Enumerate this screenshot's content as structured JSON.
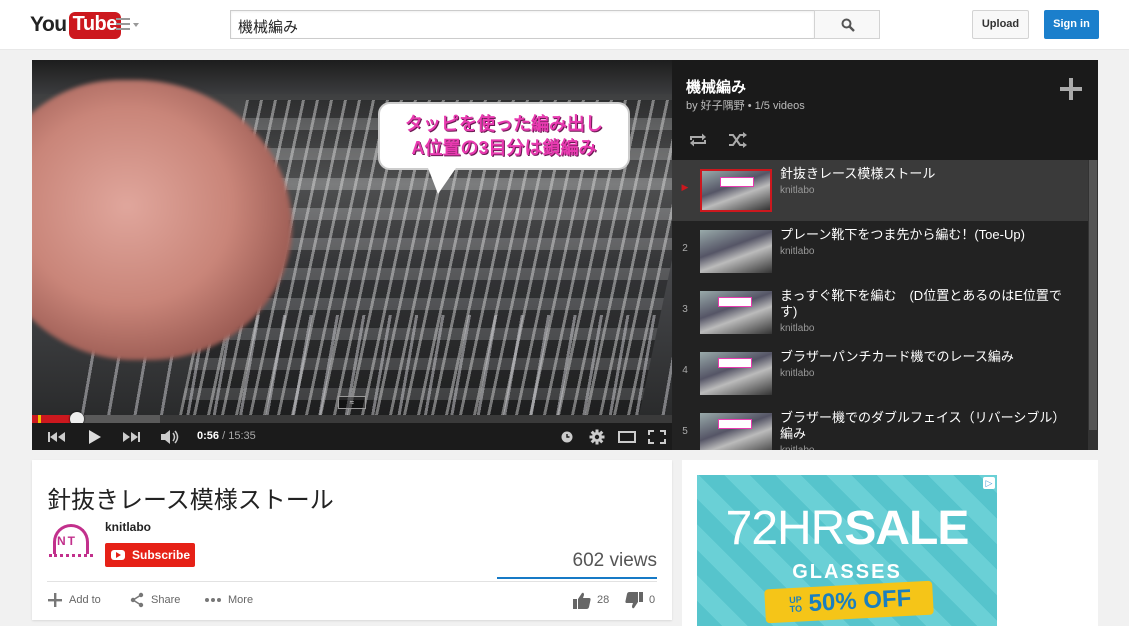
{
  "header": {
    "logo_you": "You",
    "logo_tube": "Tube",
    "search_query": "機械編み",
    "upload_label": "Upload",
    "signin_label": "Sign in"
  },
  "player": {
    "caption_line1": "タッピを使った編み出し",
    "caption_line2": "A位置の3目分は鎖編み",
    "expand_chip": "≈",
    "current_time": "0:56",
    "duration": "/ 15:35",
    "progress_fraction": 0.0599,
    "buffered_fraction": 0.2
  },
  "playlist": {
    "title": "機械編み",
    "meta": "by 好子隅野 • 1/5 videos",
    "items": [
      {
        "index": "▶",
        "title": "針抜きレース模様ストール",
        "owner": "knitlabo",
        "active": true
      },
      {
        "index": "2",
        "title": "プレーン靴下をつま先から編む！(Toe-Up)",
        "owner": "knitlabo",
        "active": false
      },
      {
        "index": "3",
        "title": "まっすぐ靴下を編む　(D位置とあるのはE位置です)",
        "owner": "knitlabo",
        "active": false
      },
      {
        "index": "4",
        "title": "ブラザーパンチカード機でのレース編み",
        "owner": "knitlabo",
        "active": false
      },
      {
        "index": "5",
        "title": "ブラザー機でのダブルフェイス（リバーシブル）編み",
        "owner": "knitlabo",
        "active": false
      }
    ]
  },
  "video": {
    "title": "針抜きレース模様ストール",
    "channel": "knitlabo",
    "avatar_text": "NT",
    "subscribe_label": "Subscribe",
    "views": "602 views",
    "add_to_label": "Add to",
    "share_label": "Share",
    "more_label": "More",
    "likes": "28",
    "dislikes": "0"
  },
  "ad": {
    "choice": "▷",
    "head_light": "72HR",
    "head_bold": "SALE",
    "sub": "GLASSES",
    "up_to": "UP TO",
    "offer": "50% OFF"
  },
  "colors": {
    "brand_red": "#cc181e",
    "signin_blue": "#1b7fcc",
    "caption_pink": "#e83ab0",
    "ad_teal": "#56c4cc"
  }
}
